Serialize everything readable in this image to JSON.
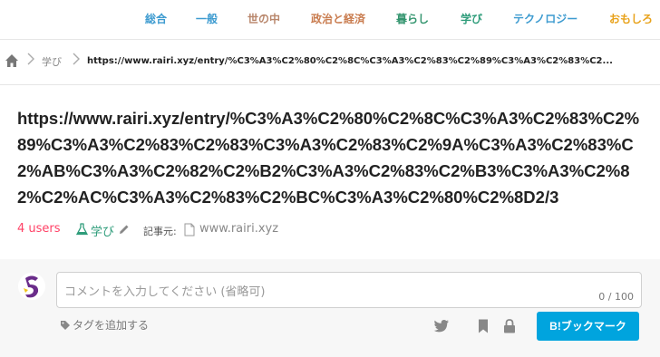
{
  "nav": {
    "categories": [
      {
        "label": "総合",
        "color": "#3d9bd0"
      },
      {
        "label": "一般",
        "color": "#3d9bd0"
      },
      {
        "label": "世の中",
        "color": "#b8866b"
      },
      {
        "label": "政治と経済",
        "color": "#c97c4f"
      },
      {
        "label": "暮らし",
        "color": "#34956f"
      },
      {
        "label": "学び",
        "color": "#2e9c7a"
      },
      {
        "label": "テクノロジー",
        "color": "#3d9bd0"
      },
      {
        "label": "おもしろ",
        "color": "#e8a21b"
      }
    ]
  },
  "breadcrumb": {
    "category": "学び",
    "current": "https://www.rairi.xyz/entry/%C3%A3%C2%80%C2%8C%C3%A3%C2%83%C2%89%C3%A3%C2%83%C2..."
  },
  "entry": {
    "title": "https://www.rairi.xyz/entry/%C3%A3%C2%80%C2%8C%C3%A3%C2%83%C2%89%C3%A3%C2%83%C2%83%C3%A3%C2%83%C2%9A%C3%A3%C2%83%C2%AB%C3%A3%C2%82%C2%B2%C3%A3%C2%83%C2%B3%C3%A3%C2%82%C2%AC%C3%A3%C2%83%C2%BC%C3%A3%C2%80%C2%8D2/3",
    "users": "4 users",
    "category": "学び",
    "source_label": "記事元:",
    "domain": "www.rairi.xyz"
  },
  "comment": {
    "placeholder": "コメントを入力してください (省略可)",
    "counter": "0 / 100",
    "add_tag": "タグを追加する",
    "bookmark_button": "ブックマーク",
    "bookmark_prefix": "B!"
  },
  "colors": {
    "accent": "#00a4de",
    "users": "#ff4166"
  }
}
